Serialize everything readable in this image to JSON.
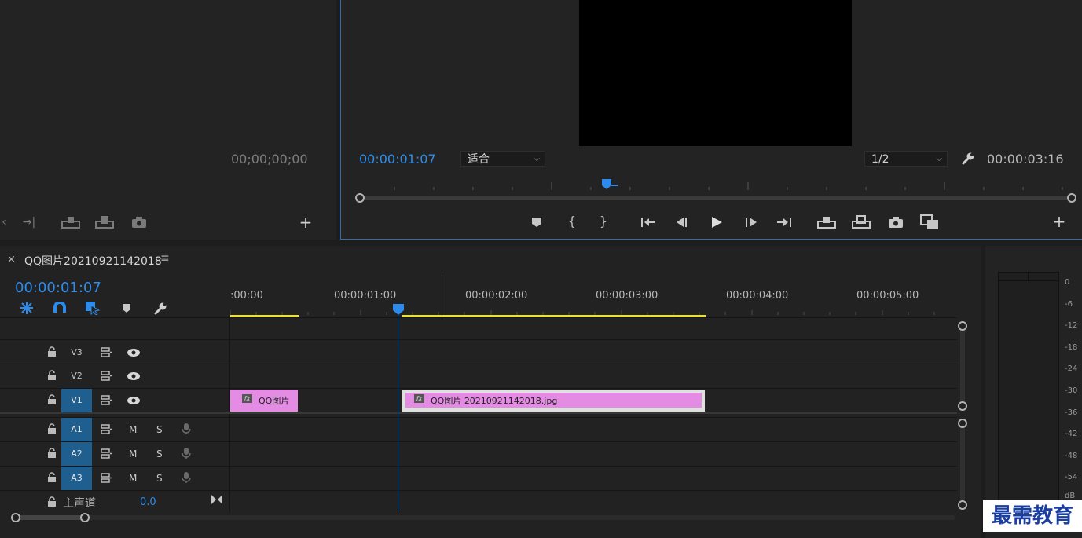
{
  "source_monitor": {
    "timecode": "00;00;00;00"
  },
  "program_monitor": {
    "current_time": "00:00:01:07",
    "fit_select": "适合",
    "resolution_select": "1/2",
    "duration": "00:00:03:16"
  },
  "timeline": {
    "tab_close": "×",
    "sequence_name": "QQ图片20210921142018",
    "menu_glyph": "≡",
    "current_time": "00:00:01:07",
    "ruler_labels": [
      ":00:00",
      "00:00:01:00",
      "00:00:02:00",
      "00:00:03:00",
      "00:00:04:00",
      "00:00:05:00"
    ],
    "tracks": [
      {
        "label": "V3"
      },
      {
        "label": "V2"
      },
      {
        "label": "V1"
      },
      {
        "label": "A1"
      },
      {
        "label": "A2"
      },
      {
        "label": "A3"
      }
    ],
    "mute_label": "M",
    "solo_label": "S",
    "master_label": "主声道",
    "master_value": "0.0",
    "clips": [
      {
        "name": "QQ图片"
      },
      {
        "name": "QQ图片 20210921142018.jpg"
      }
    ]
  },
  "audio_meter": {
    "scale": [
      "0",
      "-6",
      "-12",
      "-18",
      "-24",
      "-30",
      "-36",
      "-42",
      "-48",
      "-54",
      "dB"
    ]
  },
  "watermark": "最需教育",
  "colors": {
    "accent_blue": "#2d8ceb",
    "clip_pink": "#e48be3",
    "work_area_yellow": "#e8e13a",
    "track_blue": "#1f5f8f"
  }
}
